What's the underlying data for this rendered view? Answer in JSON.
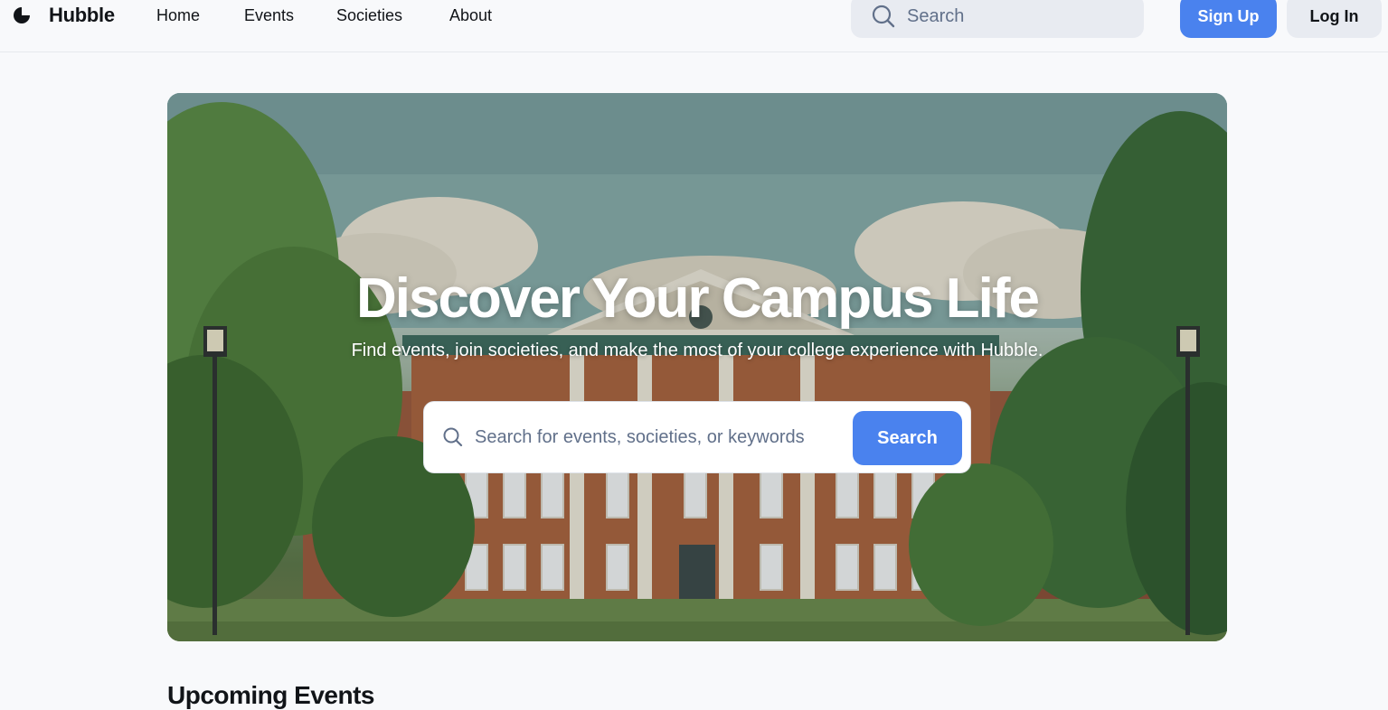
{
  "brand": {
    "name": "Hubble",
    "logo_icon": "hubble-logo-icon"
  },
  "nav": {
    "items": [
      "Home",
      "Events",
      "Societies",
      "About"
    ]
  },
  "header": {
    "search_placeholder": "Search",
    "signup_label": "Sign Up",
    "login_label": "Log In"
  },
  "hero": {
    "title": "Discover Your Campus Life",
    "subtitle": "Find events, join societies, and make the most of your college experience with Hubble.",
    "search_placeholder": "Search for events, societies, or keywords",
    "search_button": "Search",
    "image_description": "campus-building-illustration"
  },
  "sections": {
    "upcoming_title": "Upcoming Events"
  },
  "colors": {
    "accent": "#4a82ee",
    "secondary_button": "#e8ebf1",
    "background": "#f8f9fb",
    "text": "#111418",
    "muted": "#61708a"
  }
}
